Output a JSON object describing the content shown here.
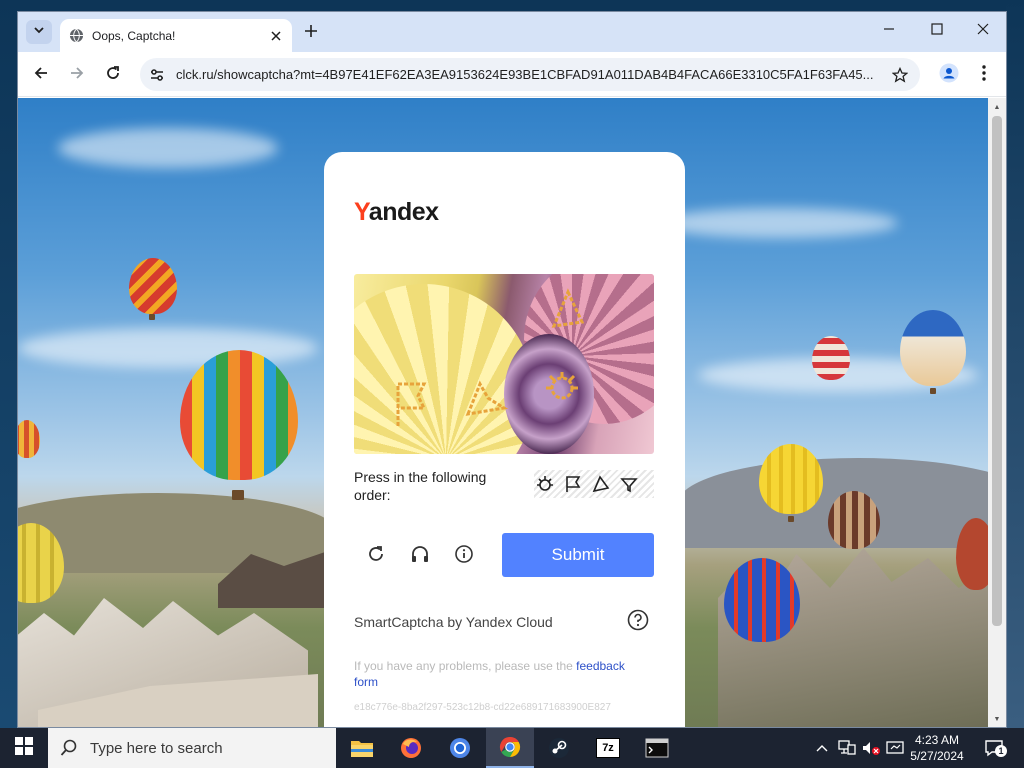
{
  "browser": {
    "tab_title": "Oops, Captcha!",
    "url": "clck.ru/showcaptcha?mt=4B97E41EF62EA3EA9153624E93BE1CBFAD91A011DAB4B4FACA66E3310C5FA1F63FA45...",
    "icons": {
      "tab_dropdown": "chevron-down-icon",
      "tab_favicon": "globe-icon",
      "tab_close": "close-icon",
      "new_tab": "plus-icon",
      "back": "back-arrow-icon",
      "forward": "forward-arrow-icon",
      "reload": "reload-icon",
      "site_info": "tune-icon",
      "bookmark": "star-icon",
      "profile": "profile-icon",
      "menu": "kebab-menu-icon",
      "minimize": "minimize-icon",
      "maximize": "maximize-icon",
      "close_window": "close-window-icon"
    }
  },
  "captcha": {
    "brand_first_letter": "Y",
    "brand_rest": "andex",
    "instruction": "Press in the following order:",
    "order_icons": [
      "bug-icon",
      "flag-icon",
      "cone-icon",
      "funnel-icon"
    ],
    "submit_label": "Submit",
    "controls": [
      "refresh-icon",
      "headphones-icon",
      "info-icon"
    ],
    "provider_label": "SmartCaptcha by Yandex Cloud",
    "feedback_text": "If you have any problems, please use the",
    "feedback_link": "feedback form",
    "request_id": "e18c776e-8ba2f297-523c12b8-cd22e689171683900E827",
    "accent_color": "#5282ff",
    "brand_color": "#fc3f1d"
  },
  "taskbar": {
    "search_placeholder": "Type here to search",
    "apps": [
      "file-explorer-icon",
      "firefox-icon",
      "chromium-icon",
      "chrome-icon",
      "steam-icon",
      "7zip-icon",
      "terminal-icon"
    ],
    "app_7zip_label": "7z",
    "time": "4:23 AM",
    "date": "5/27/2024",
    "notification_count": "1"
  }
}
